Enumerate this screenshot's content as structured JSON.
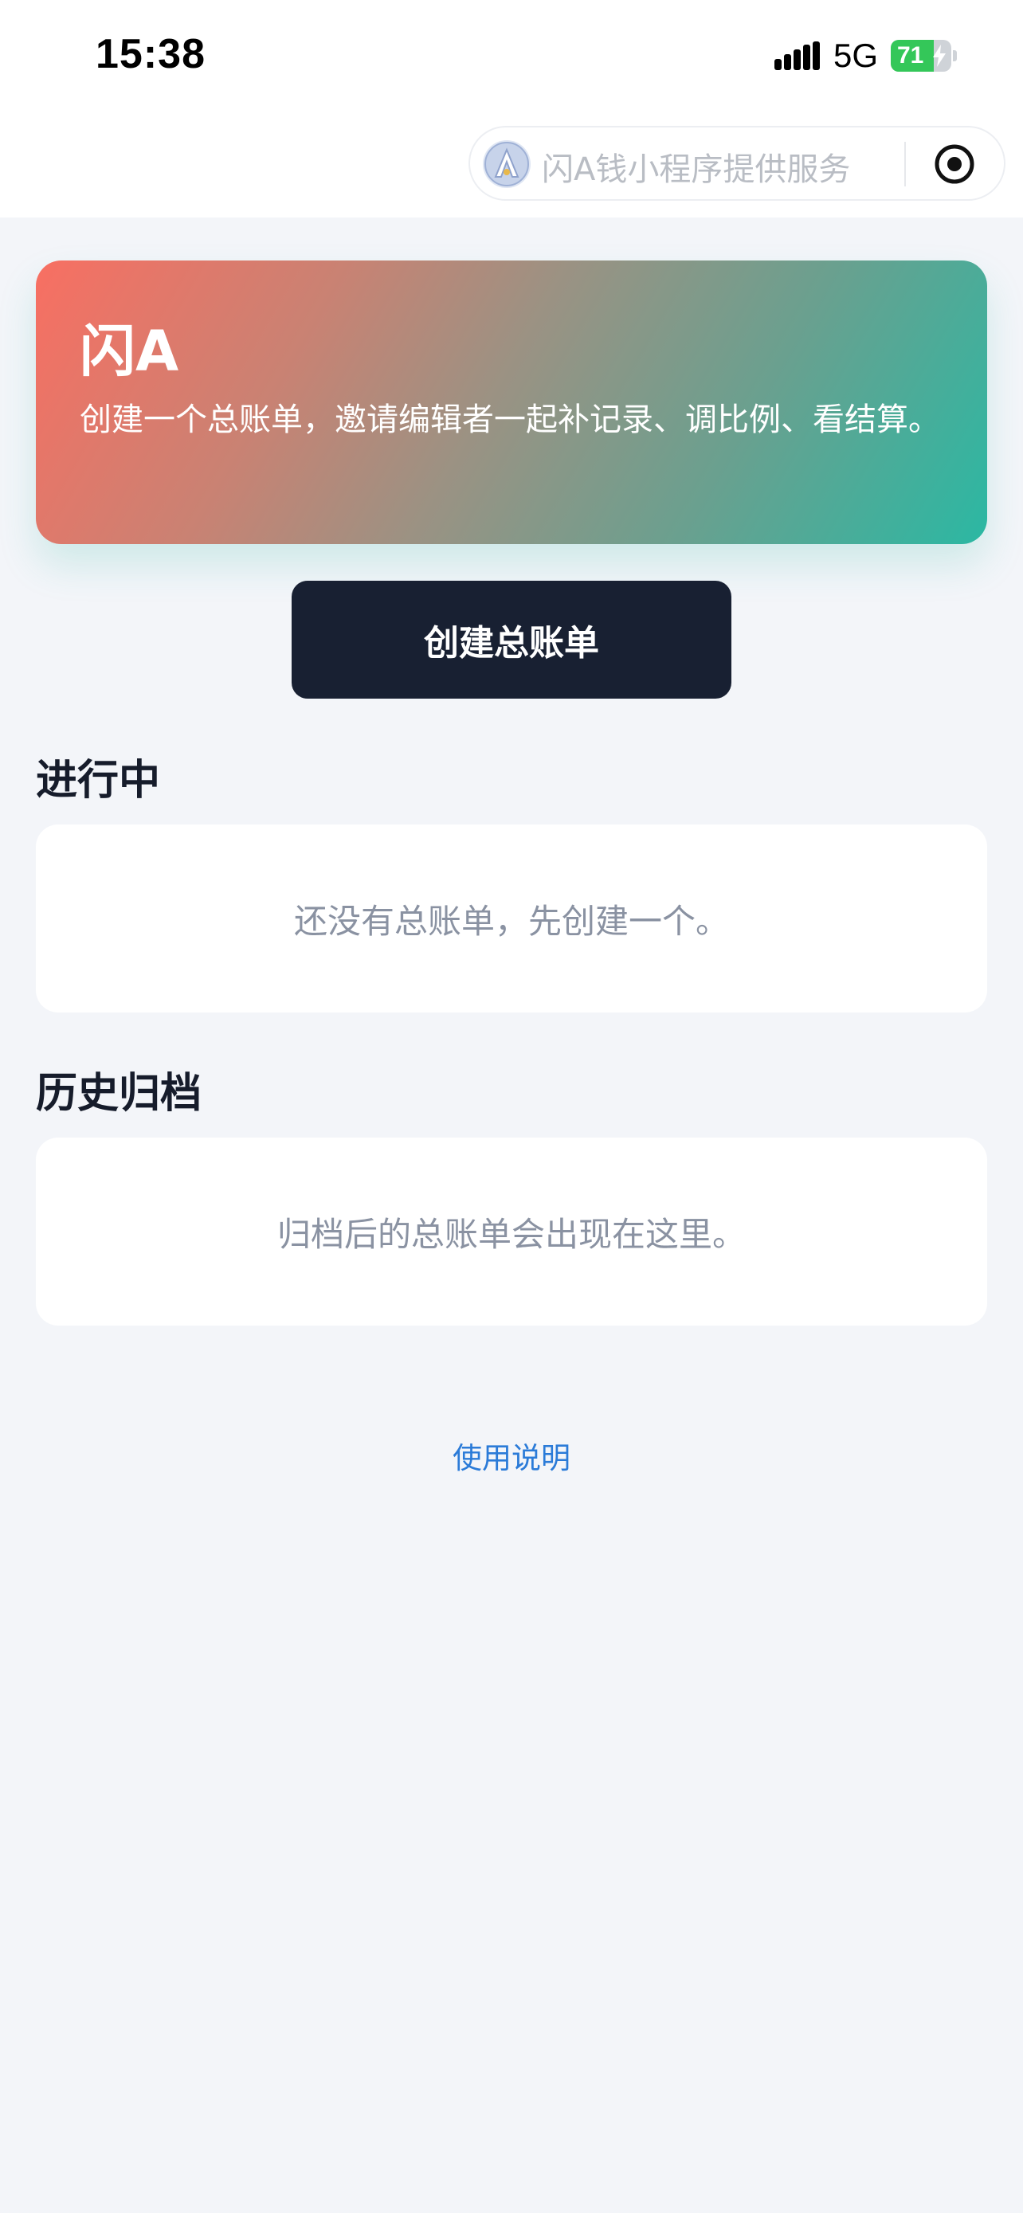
{
  "status_bar": {
    "time": "15:38",
    "network": "5G",
    "battery_level": "71",
    "battery_fraction": 0.71,
    "signal_icon": "signal-bars-icon",
    "charging_icon": "bolt-icon"
  },
  "capsule": {
    "provider_text": "闪A钱小程序提供服务",
    "logo_icon": "app-logo-icon",
    "record_icon": "record-target-icon"
  },
  "hero": {
    "title": "闪A",
    "description": "创建一个总账单，邀请编辑者一起补记录、调比例、看结算。"
  },
  "actions": {
    "create_label": "创建总账单"
  },
  "sections": {
    "active_title": "进行中",
    "active_empty": "还没有总账单，先创建一个。",
    "archive_title": "历史归档",
    "archive_empty": "归档后的总账单会出现在这里。"
  },
  "footer": {
    "help_link": "使用说明"
  },
  "colors": {
    "accent_dark": "#182032",
    "link": "#2b7bd8",
    "gradient_start": "#f86f62",
    "gradient_end": "#2bb8a3",
    "battery": "#34c759"
  }
}
